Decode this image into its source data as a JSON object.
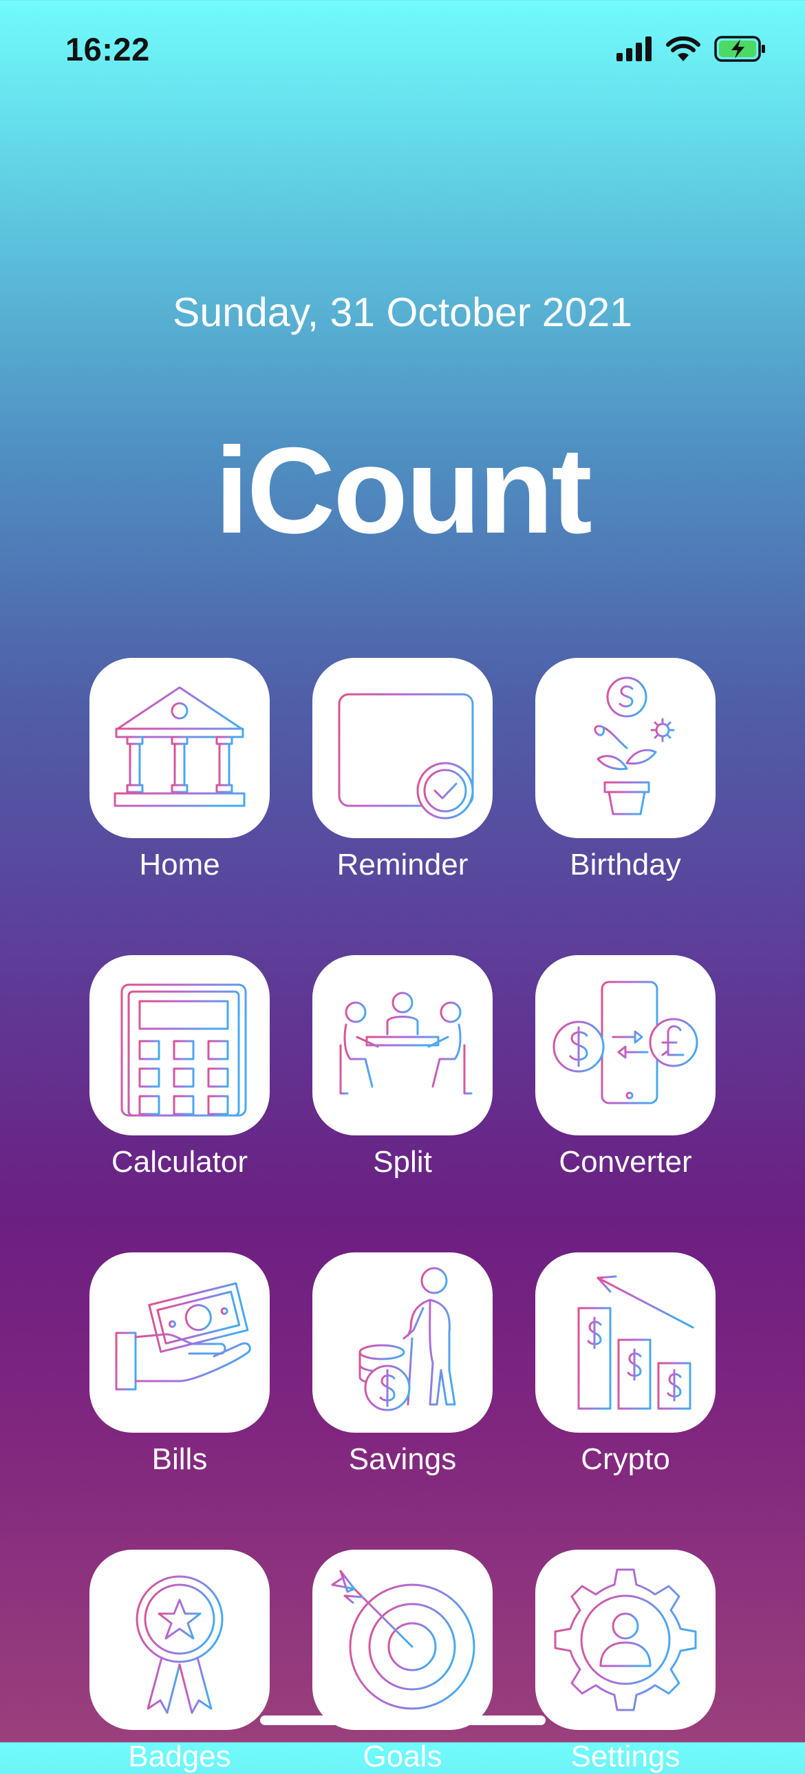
{
  "status_bar": {
    "time": "16:22",
    "signal_icon": "cellular-signal-icon",
    "wifi_icon": "wifi-icon",
    "battery_icon": "battery-charging-icon",
    "battery_color": "#4cd964"
  },
  "header": {
    "date": "Sunday, 31 October 2021",
    "title": "iCount"
  },
  "accent": {
    "gradient_start": "#e0518a",
    "gradient_end": "#4aa8f0"
  },
  "apps": [
    {
      "label": "Home",
      "icon": "bank-building-icon"
    },
    {
      "label": "Reminder",
      "icon": "calendar-check-icon"
    },
    {
      "label": "Birthday",
      "icon": "money-plant-icon"
    },
    {
      "label": "Calculator",
      "icon": "calculator-icon"
    },
    {
      "label": "Split",
      "icon": "people-table-icon"
    },
    {
      "label": "Converter",
      "icon": "currency-exchange-icon"
    },
    {
      "label": "Bills",
      "icon": "hand-cash-icon"
    },
    {
      "label": "Savings",
      "icon": "elder-coins-icon"
    },
    {
      "label": "Crypto",
      "icon": "dollar-chart-icon"
    },
    {
      "label": "Badges",
      "icon": "award-ribbon-icon"
    },
    {
      "label": "Goals",
      "icon": "target-arrow-icon"
    },
    {
      "label": "Settings",
      "icon": "user-gear-icon"
    }
  ]
}
